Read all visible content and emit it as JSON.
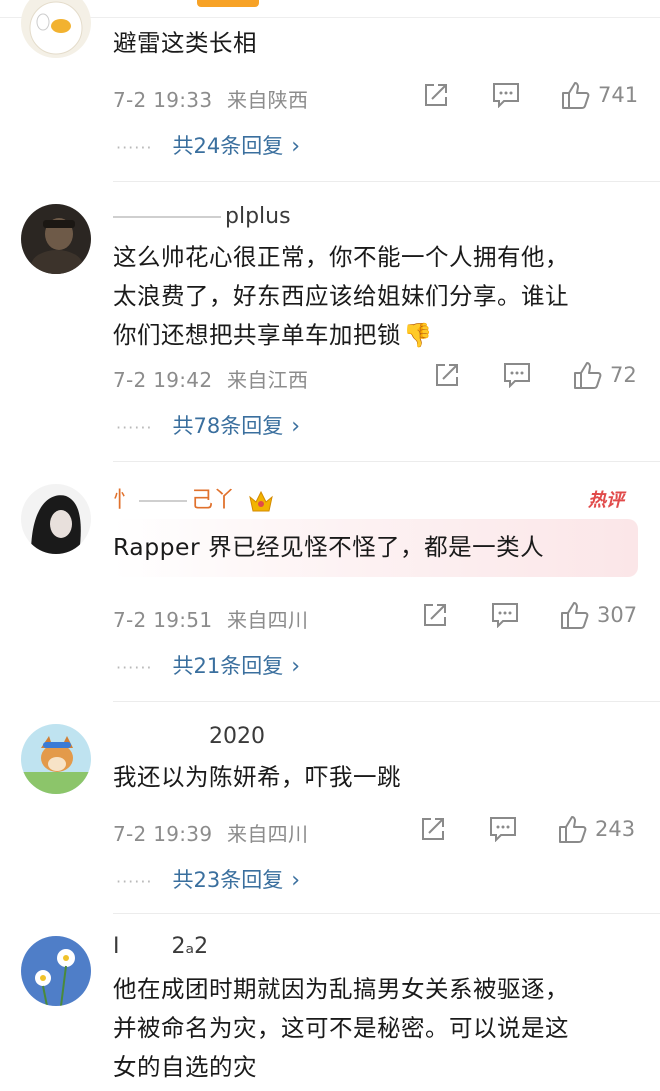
{
  "colors": {
    "accent": "#f7a226",
    "link": "#3a6f9e",
    "meta": "#8c8c8c",
    "hot": "#e14b4b"
  },
  "icons": {
    "repost": "share-square-icon",
    "comment": "comment-bubble-icon",
    "like": "thumbs-up-icon",
    "more": "chevron-right-icon"
  },
  "comments": [
    {
      "username": "",
      "content": "避雷这类长相",
      "date": "7-2 19:33",
      "location": "来自陕西",
      "likes": "741",
      "replies": "共24条回复"
    },
    {
      "username": "plplus",
      "content_lines": [
        "这么帅花心很正常，你不能一个人拥有他，",
        "太浪费了，好东西应该给姐妹们分享。谁让",
        "你们还想把共享单车加把锁"
      ],
      "emoji": "👎",
      "date": "7-2 19:42",
      "location": "来自江西",
      "likes": "72",
      "replies": "共78条回复"
    },
    {
      "username_prefix": "忄",
      "username": "己丫",
      "badge": "热评",
      "content": "Rapper 界已经见怪不怪了，都是一类人",
      "date": "7-2 19:51",
      "location": "来自四川",
      "likes": "307",
      "replies": "共21条回复"
    },
    {
      "username": "2020",
      "content": "我还以为陈妍希，吓我一跳",
      "date": "7-2 19:39",
      "location": "来自四川",
      "likes": "243",
      "replies": "共23条回复"
    },
    {
      "username_prefix": "I",
      "username": "2ₐ2",
      "content_lines": [
        "他在成团时期就因为乱搞男女关系被驱逐，",
        "并被命名为灾，这可不是秘密。可以说是这",
        "女的自选的灾"
      ]
    }
  ],
  "reply_dots": "······",
  "chevron": "›"
}
